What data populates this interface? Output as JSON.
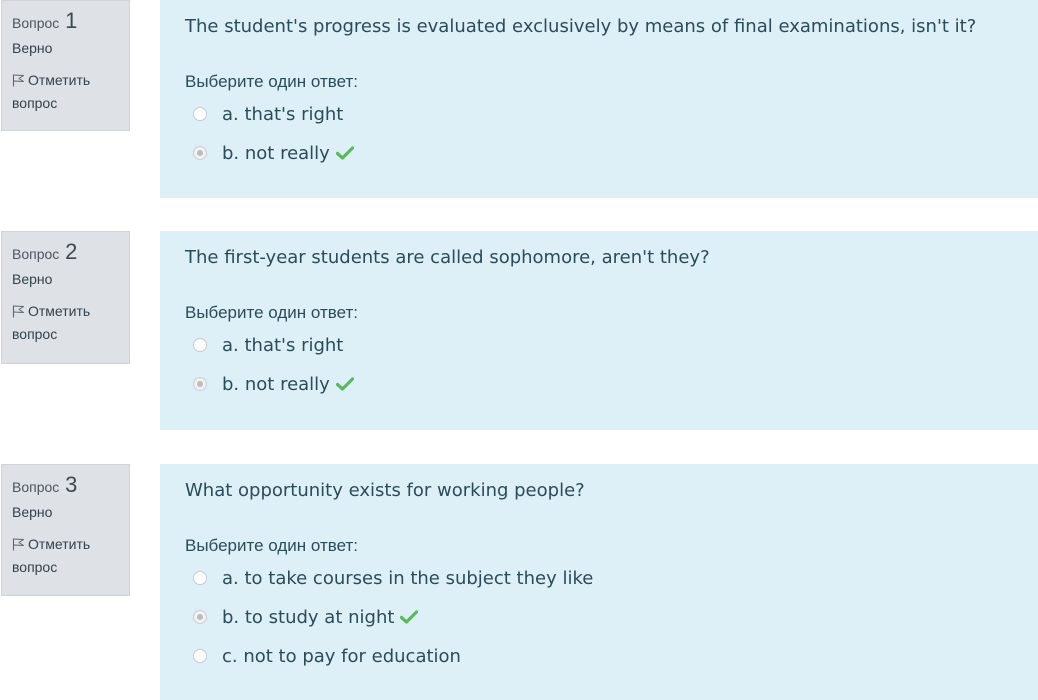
{
  "prompt_label": "Выберите один ответ:",
  "questions": [
    {
      "label": "Вопрос",
      "number": "1",
      "state": "Верно",
      "flag_label": "Отметить вопрос",
      "text": "The student's progress is evaluated exclusively by means of final examinations, isn't it?",
      "answers": [
        {
          "text": "a. that's right",
          "selected": false,
          "correct": false
        },
        {
          "text": "b. not really",
          "selected": true,
          "correct": true
        }
      ]
    },
    {
      "label": "Вопрос",
      "number": "2",
      "state": "Верно",
      "flag_label": "Отметить вопрос",
      "text": "The first-year students are called sophomore, aren't they?",
      "answers": [
        {
          "text": "a. that's right",
          "selected": false,
          "correct": false
        },
        {
          "text": "b. not really",
          "selected": true,
          "correct": true
        }
      ]
    },
    {
      "label": "Вопрос",
      "number": "3",
      "state": "Верно",
      "flag_label": "Отметить вопрос",
      "text": "What opportunity exists for working people?",
      "answers": [
        {
          "text": "a. to take courses in the subject they like",
          "selected": false,
          "correct": false
        },
        {
          "text": "b. to study at night",
          "selected": true,
          "correct": true
        },
        {
          "text": "c. not to pay for education",
          "selected": false,
          "correct": false
        }
      ]
    }
  ],
  "colors": {
    "info_background": "#dee2e6",
    "content_background": "#def0f7",
    "correct_check": "#5cb85c",
    "text": "#2c4b58"
  },
  "icons": {
    "flag": "flag-icon",
    "correct": "check-icon"
  }
}
